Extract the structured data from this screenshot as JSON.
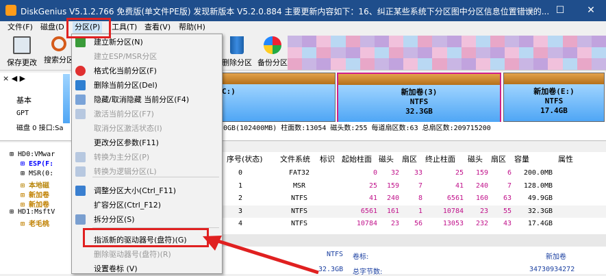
{
  "title": "DiskGenius V5.1.2.766 免费版(单文件PE版)   发现新版本 V5.2.0.884 主要更新内容如下：16、纠正某些系统下分区图中分区信息位置错误的...",
  "window": {
    "min": "—",
    "max": "☐",
    "close": "✕"
  },
  "menu": [
    "文件(F)",
    "磁盘(D",
    "分区(P)",
    "工具(T)",
    "查看(V)",
    "帮助(H)"
  ],
  "toolbar": {
    "save": "保存更改",
    "search": "搜索分区",
    "delete": "删除分区",
    "backup": "备份分区"
  },
  "disk_nav": {
    "basic": "基本",
    "gpt": "GPT",
    "disk_label": "磁盘 0 接口:Sa"
  },
  "partitions": [
    {
      "name": "C:)",
      "fs": "",
      "size": ""
    },
    {
      "name": "新加卷(3)",
      "fs": "NTFS",
      "size": "32.3GB"
    },
    {
      "name": "新加卷(E:)",
      "fs": "NTFS",
      "size": "17.4GB"
    }
  ],
  "disk_info": "0GB(102400MB)  柱面数:13054  磁头数:255  每道扇区数:63  总扇区数:209715200",
  "tree": [
    {
      "text": "HD0:VMwar",
      "color": "#000"
    },
    {
      "text": "ESP(F:",
      "color": "#0000ff"
    },
    {
      "text": "MSR(0:",
      "color": "#000"
    },
    {
      "text": "本地磁",
      "color": "#b8860b"
    },
    {
      "text": "新加卷",
      "color": "#c08000"
    },
    {
      "text": "新加卷",
      "color": "#c08000"
    },
    {
      "text": "HD1:MsftV",
      "color": "#000"
    },
    {
      "text": "老毛桃",
      "color": "#c08000"
    }
  ],
  "grid": {
    "headers": [
      "序号(状态)",
      "文件系统",
      "标识",
      "起始柱面",
      "磁头",
      "扇区",
      "终止柱面",
      "磁头",
      "扇区",
      "容量",
      "属性"
    ],
    "rows": [
      [
        "0",
        "FAT32",
        "",
        "0",
        "32",
        "33",
        "25",
        "159",
        "6",
        "200.0MB",
        ""
      ],
      [
        "1",
        "MSR",
        "",
        "25",
        "159",
        "7",
        "41",
        "240",
        "7",
        "128.0MB",
        ""
      ],
      [
        "2",
        "NTFS",
        "",
        "41",
        "240",
        "8",
        "6561",
        "160",
        "63",
        "49.9GB",
        ""
      ],
      [
        "3",
        "NTFS",
        "",
        "6561",
        "161",
        "1",
        "10784",
        "23",
        "55",
        "32.3GB",
        ""
      ],
      [
        "4",
        "NTFS",
        "",
        "10784",
        "23",
        "56",
        "13053",
        "232",
        "43",
        "17.4GB",
        ""
      ]
    ]
  },
  "detail": {
    "fs": "NTFS",
    "vol_label_key": "卷标:",
    "vol_label": "新加卷",
    "size": "32.3GB",
    "bytes_key": "总字节数:",
    "bytes": "34730934272"
  },
  "context_menu": [
    {
      "label": "建立新分区(N)",
      "disabled": false
    },
    {
      "label": "建立ESP/MSR分区",
      "disabled": true
    },
    {
      "label": "格式化当前分区(F)",
      "disabled": false
    },
    {
      "label": "删除当前分区(Del)",
      "disabled": false
    },
    {
      "label": "隐藏/取消隐藏 当前分区(F4)",
      "disabled": false
    },
    {
      "label": "激活当前分区(F7)",
      "disabled": true
    },
    {
      "label": "取消分区激活状态(I)",
      "disabled": true
    },
    {
      "label": "更改分区参数(F11)",
      "disabled": false
    },
    {
      "label": "转换为主分区(P)",
      "disabled": true
    },
    {
      "label": "转换为逻辑分区(L)",
      "disabled": true
    },
    {
      "label": "调整分区大小(Ctrl_F11)",
      "disabled": false
    },
    {
      "label": "扩容分区(Ctrl_F12)",
      "disabled": false
    },
    {
      "label": "拆分分区(S)",
      "disabled": false
    },
    {
      "label": "指派新的驱动器号(盘符)(G)",
      "disabled": false
    },
    {
      "label": "删除驱动器号(盘符)(R)",
      "disabled": true
    },
    {
      "label": "设置卷标 (V)",
      "disabled": false
    }
  ],
  "colors": {
    "titlebar": "#1f4e8c",
    "highlight": "#e02020",
    "partition_top": "#c8862e",
    "partition_body": "#6bb8ff"
  },
  "icons": [
    "save-icon",
    "search-icon",
    "delete-icon",
    "backup-icon"
  ]
}
